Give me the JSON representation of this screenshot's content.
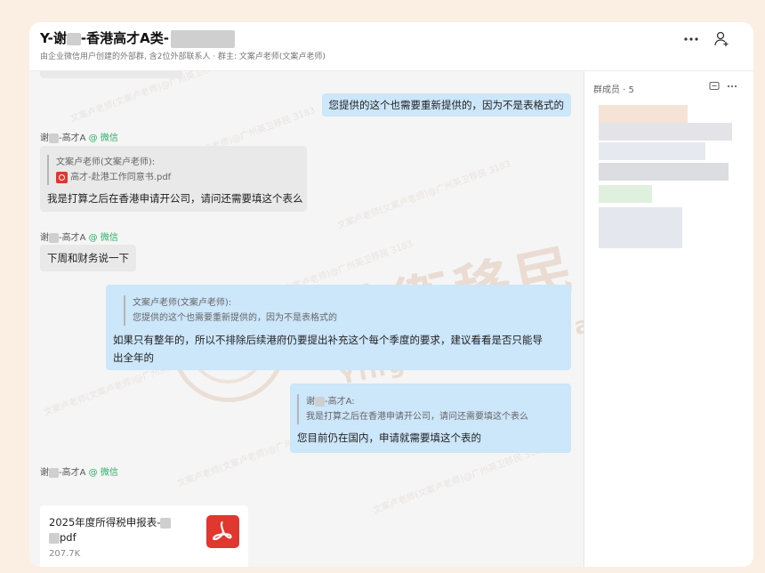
{
  "header": {
    "title_prefix": "Y-谢",
    "title_mid": "-香港高才A类-",
    "subtitle": "由企业微信用户创建的外部群, 含2位外部联系人 · 群主: 文案卢老师(文案卢老师)"
  },
  "messages": {
    "m1": {
      "text": "您提供的这个也需要重新提供的，因为不是表格式的"
    },
    "s1": {
      "name_a": "谢",
      "name_b": "-高才A",
      "tag": "@ 微信"
    },
    "m2": {
      "quote_author": "文案卢老师(文案卢老师):",
      "quote_file": "高才-赴港工作同意书.pdf",
      "text": "我是打算之后在香港申请开公司，请问还需要填这个表么"
    },
    "s2": {
      "name_a": "谢",
      "name_b": "-高才A",
      "tag": "@ 微信"
    },
    "m3": {
      "text": "下周和财务说一下"
    },
    "m4": {
      "quote_author": "文案卢老师(文案卢老师):",
      "quote_text": "您提供的这个也需要重新提供的，因为不是表格式的",
      "text_line1": "如果只有整年的，所以不排除后续港府仍要提出补充这个每个季度的要求，建议看看是否只能导",
      "text_line2": "出全年的"
    },
    "m5": {
      "quote_author_a": "谢",
      "quote_author_b": "-高才A:",
      "quote_text": "我是打算之后在香港申请开公司，请问还需要填这个表么",
      "text": "您目前仍在国内，申请就需要填这个表的"
    },
    "s3": {
      "name_a": "谢",
      "name_b": "-高才A",
      "tag": "@ 微信"
    },
    "file": {
      "name_line1": "2025年度所得税申报表-",
      "name_line2": "pdf",
      "size": "207.7K"
    }
  },
  "sidebar": {
    "members_label": "群成员 · 5"
  },
  "watermark": {
    "line": "文案卢老师(文案卢老师)@广州英卫移民 3183",
    "brand_cn": "英衛移民",
    "brand_en": "Yingwei immigration"
  },
  "colors": {
    "page_bg": "#fbeee2",
    "my_bubble": "#cce6fa",
    "other_bubble": "#e9e9e9",
    "wechat_green": "#2aae67",
    "pdf_red": "#e0372f"
  },
  "icons": [
    "more-icon",
    "add-member-icon",
    "pdf-icon",
    "chat-icon",
    "blurred-avatar-icon"
  ]
}
